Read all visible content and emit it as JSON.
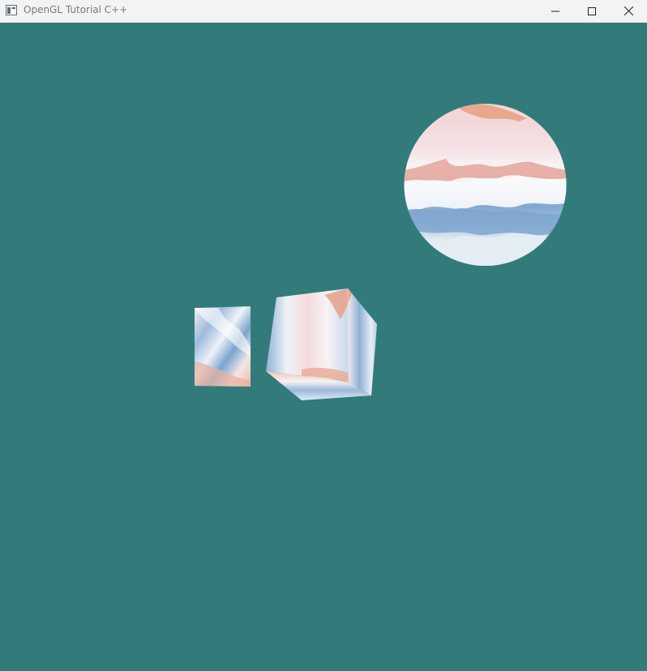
{
  "window": {
    "title": "OpenGL Tutorial C++"
  },
  "colors": {
    "titlebar_bg": "#f3f3f3",
    "title_text": "#7a7a7a",
    "viewport_clear": "#337b7b",
    "texture_blue": "#6f9fcb",
    "texture_peach": "#e8a38e",
    "texture_white": "#fbfbfd"
  },
  "icons": {
    "app": "window-app-icon",
    "minimize": "minimize-icon",
    "maximize": "maximize-icon",
    "close": "close-icon"
  },
  "scene": {
    "objects": [
      "textured-sphere",
      "textured-plane",
      "textured-cube"
    ]
  }
}
